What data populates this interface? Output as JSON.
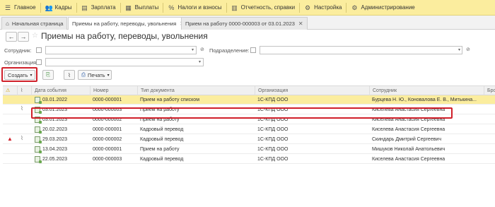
{
  "topmenu": {
    "items": [
      {
        "label": "Главное",
        "icon": "menu-icon"
      },
      {
        "label": "Кадры",
        "icon": "people-icon"
      },
      {
        "label": "Зарплата",
        "icon": "payroll-icon"
      },
      {
        "label": "Выплаты",
        "icon": "payments-icon"
      },
      {
        "label": "Налоги и взносы",
        "icon": "percent-icon"
      },
      {
        "label": "Отчетность, справки",
        "icon": "reports-icon"
      },
      {
        "label": "Настройка",
        "icon": "settings-icon"
      },
      {
        "label": "Администрирование",
        "icon": "gear-icon"
      }
    ]
  },
  "tabs": [
    {
      "label": "Начальная страница"
    },
    {
      "label": "Приемы на работу, переводы, увольнения"
    },
    {
      "label": "Прием на работу 0000-000003 от 03.01.2023"
    }
  ],
  "window": {
    "title": "Приемы на работу, переводы, увольнения"
  },
  "filters": {
    "employee_label": "Сотрудник:",
    "department_label": "Подразделение:",
    "organization_label": "Организация:"
  },
  "toolbar": {
    "create_label": "Создать",
    "print_label": "Печать"
  },
  "table": {
    "columns": [
      "Дата события",
      "Номер",
      "Тип документа",
      "Организация",
      "Сотрудник",
      "Бро"
    ],
    "rows": [
      {
        "date": "03.01.2022",
        "number": "0000-000001",
        "type": "Прием на работу списком",
        "org": "1С-КПД ООО",
        "employee": "Бурцева Н. Ю., Коновалова Е. В., Митькина...",
        "warn": false,
        "clip": false,
        "selected": true
      },
      {
        "date": "03.01.2023",
        "number": "0000-000003",
        "type": "Прием на работу",
        "org": "1С-КПД ООО",
        "employee": "Киселева Анастасия Сергеевна",
        "warn": false,
        "clip": true,
        "selected": false
      },
      {
        "date": "03.01.2023",
        "number": "0000-000002",
        "type": "Прием на работу",
        "org": "1С-КПД ООО",
        "employee": "Киселева Анастасия Сергеевна",
        "warn": false,
        "clip": false,
        "selected": false
      },
      {
        "date": "20.02.2023",
        "number": "0000-000001",
        "type": "Кадровый перевод",
        "org": "1С-КПД ООО",
        "employee": "Киселева Анастасия Сергеевна",
        "warn": false,
        "clip": false,
        "selected": false
      },
      {
        "date": "29.03.2023",
        "number": "0000-000002",
        "type": "Кадровый перевод",
        "org": "1С-КПД ООО",
        "employee": "Скиндарь Дмитрий Сергеевич",
        "warn": true,
        "clip": true,
        "selected": false
      },
      {
        "date": "13.04.2023",
        "number": "0000-000001",
        "type": "Прием на работу",
        "org": "1С-КПД ООО",
        "employee": "Мишуков Николай Анатольевич",
        "warn": false,
        "clip": false,
        "selected": false
      },
      {
        "date": "22.05.2023",
        "number": "0000-000003",
        "type": "Кадровый перевод",
        "org": "1С-КПД ООО",
        "employee": "Киселева Анастасия Сергеевна",
        "warn": false,
        "clip": false,
        "selected": false
      }
    ]
  },
  "colors": {
    "menu_bg": "#fbed9e",
    "selected_row": "#fbed9e",
    "highlight": "#d0202a"
  }
}
